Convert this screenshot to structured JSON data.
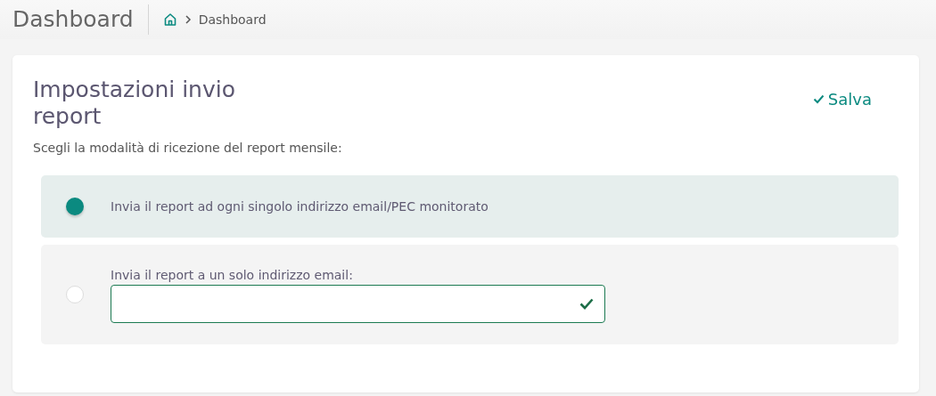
{
  "header": {
    "title": "Dashboard",
    "breadcrumb": [
      "Dashboard"
    ]
  },
  "card": {
    "title": "Impostazioni invio report",
    "save_label": "Salva",
    "subtitle": "Scegli la modalità di ricezione del report mensile:",
    "options": [
      {
        "kind": "plain",
        "label": "Invia il report ad ogni singolo indirizzo email/PEC monitorato",
        "selected": true
      },
      {
        "kind": "email",
        "label": "Invia il report a un solo indirizzo email:",
        "selected": false,
        "field": {
          "valid": true
        }
      }
    ]
  }
}
